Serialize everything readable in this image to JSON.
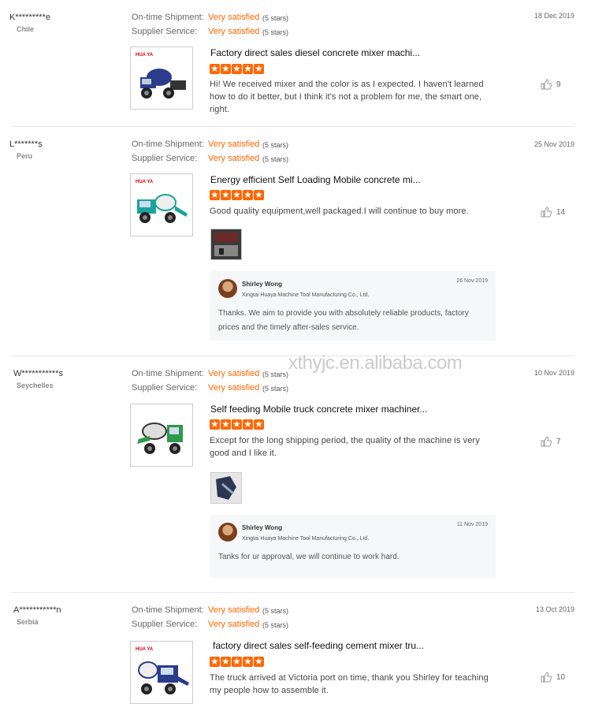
{
  "watermark": "xthyjc.en.alibaba.com",
  "labels": {
    "on_time": "On-time Shipment:",
    "supplier": "Supplier Service:"
  },
  "reviews": [
    {
      "buyer": "K*********e",
      "country": "Chile",
      "date": "18 Dec 2019",
      "on_time_value": "Very satisfied",
      "on_time_stars": "(5 stars)",
      "supplier_value": "Very satisfied",
      "supplier_stars": "(5 stars)",
      "product_title": "Factory direct sales diesel concrete mixer machi...",
      "thumb_brand": "HUA YA",
      "rating": 5,
      "comment": "Hi!  We received mixer and the color is as I expected. I haven't learned how to do it better, but I think it's not a problem for me, the smart one, right.",
      "likes": "9"
    },
    {
      "buyer": "L*******s",
      "country": "Peru",
      "date": "25 Nov 2019",
      "on_time_value": "Very satisfied",
      "on_time_stars": "(5 stars)",
      "supplier_value": "Very satisfied",
      "supplier_stars": "(5 stars)",
      "product_title": "Energy efficient Self Loading Mobile concrete mi...",
      "thumb_brand": "HUA YA",
      "rating": 5,
      "comment": "Good quality equipment,well packaged.I will continue to buy more.",
      "likes": "14",
      "reply": {
        "name": "Shirley Wong",
        "company": "Xingtai Huaya Machine Tool Manufacturing Co., Ltd.",
        "date": "26 Nov 2019",
        "text": "Thanks. We aim to provide you with absolutely reliable products, factory prices and the timely after-sales service."
      }
    },
    {
      "buyer": "W***********s",
      "country": "Seychelles",
      "date": "10 Nov 2019",
      "on_time_value": "Very satisfied",
      "on_time_stars": "(5 stars)",
      "supplier_value": "Very satisfied",
      "supplier_stars": "(5 stars)",
      "product_title": "Self feeding Mobile truck concrete mixer machiner...",
      "rating": 5,
      "comment": "Except for the long shipping period, the quality of the machine is very good and I like it.",
      "likes": "7",
      "reply": {
        "name": "Shirley Wong",
        "company": "Xingtai Huaya Machine Tool Manufacturing Co., Ltd.",
        "date": "11 Nov 2019",
        "text": "Tanks for ur approval, we will continue to work hard."
      }
    },
    {
      "buyer": "A***********n",
      "country": "Serbia",
      "date": "13 Oct 2019",
      "on_time_value": "Very satisfied",
      "on_time_stars": "(5 stars)",
      "supplier_value": "Very satisfied",
      "supplier_stars": "(5 stars)",
      "product_title": "factory direct sales self-feeding cement mixer tru...",
      "thumb_brand": "HUA YA",
      "rating": 5,
      "comment": "The truck arrived at Victoria port on time, thank you Shirley for teaching my people how to assemble it.",
      "likes": "10"
    }
  ]
}
